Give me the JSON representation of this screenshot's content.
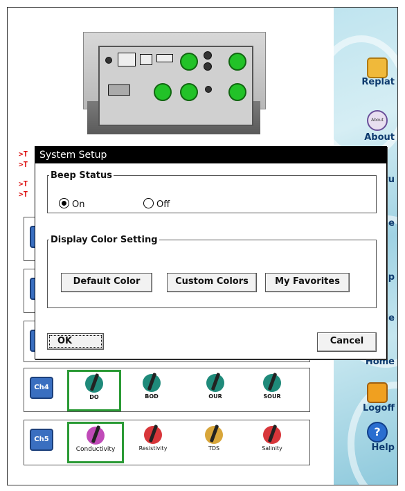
{
  "sidebar": {
    "items": [
      {
        "label": "Replat",
        "icon": "replay-icon"
      },
      {
        "label": "About",
        "icon": "about-icon"
      },
      {
        "label": "etu",
        "icon": "monitor-icon"
      },
      {
        "label": "nne",
        "icon": "gauge-icon"
      },
      {
        "label": "etup",
        "icon": "setup-icon"
      },
      {
        "label": "ofile",
        "icon": "profile-icon"
      },
      {
        "label": "Home",
        "icon": "home-icon"
      },
      {
        "label": "Logoff",
        "icon": "key-icon"
      },
      {
        "label": "Help",
        "icon": "help-icon"
      }
    ],
    "about_badge": "About"
  },
  "log": {
    "lines": [
      ">T",
      ">T",
      ">T",
      ">T"
    ]
  },
  "channels": [
    {
      "badge": "Ch4",
      "sensors": [
        {
          "label": "DO",
          "selected": true,
          "color": "#1f8a7a"
        },
        {
          "label": "BOD",
          "selected": false,
          "color": "#1f8a7a"
        },
        {
          "label": "OUR",
          "selected": false,
          "color": "#1f8a7a"
        },
        {
          "label": "SOUR",
          "selected": false,
          "color": "#1f8a7a"
        }
      ]
    },
    {
      "badge": "Ch5",
      "sensors": [
        {
          "label": "Conductivity",
          "selected": true,
          "color": "#c04ab8"
        },
        {
          "label": "Resistivity",
          "selected": false,
          "color": "#d8363a"
        },
        {
          "label": "TDS",
          "selected": false,
          "color": "#d8a63a"
        },
        {
          "label": "Salinity",
          "selected": false,
          "color": "#d8363a"
        }
      ]
    }
  ],
  "dialog": {
    "title": "System Setup",
    "beep": {
      "legend": "Beep Status",
      "on_label": "On",
      "off_label": "Off",
      "selected": "On"
    },
    "color": {
      "legend": "Display Color Setting",
      "default_label": "Default Color",
      "custom_label": "Custom Colors",
      "favorites_label": "My Favorites"
    },
    "ok_label": "OK",
    "cancel_label": "Cancel"
  },
  "colors": {
    "accent_green": "#2a9a35",
    "title_bar": "#000000",
    "log_red": "#dd1111",
    "sidebar_text": "#0d3a6e"
  }
}
